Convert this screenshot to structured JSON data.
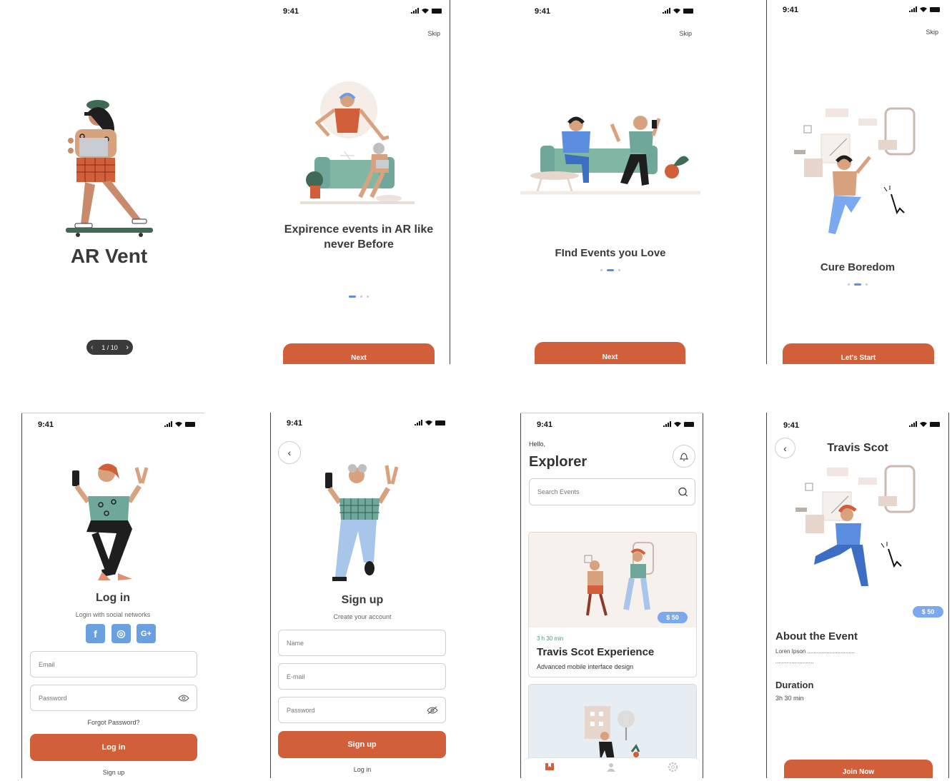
{
  "status_time": "9:41",
  "splash": {
    "title": "AR Vent",
    "pager": "1 / 10"
  },
  "onboarding": [
    {
      "title": "Expirence events in AR like never Before",
      "skip": "Skip",
      "cta": "Next"
    },
    {
      "title": "FInd Events you Love",
      "skip": "Skip",
      "cta": "Next"
    },
    {
      "title": "Cure Boredom",
      "skip": "Skip",
      "cta": "Let's Start"
    }
  ],
  "login": {
    "title": "Log in",
    "subtitle": "Login with social networks",
    "social": [
      "f",
      "◎",
      "G+"
    ],
    "email_placeholder": "Email",
    "password_placeholder": "Password",
    "forgot": "Forgot Password?",
    "cta": "Log in",
    "alt_link": "Sign up"
  },
  "signup": {
    "title": "Sign up",
    "subtitle": "Create your account",
    "name_placeholder": "Name",
    "email_placeholder": "E-mail",
    "password_placeholder": "Password",
    "cta": "Sign up",
    "alt_link": "Log in"
  },
  "explore": {
    "greeting": "Hello,",
    "name": "Explorer",
    "search_placeholder": "Search Events",
    "event": {
      "price": "$ 50",
      "duration": "3 h 30 min",
      "title": "Travis Scot Experience",
      "description": "Advanced mobile interface design"
    },
    "tabs": [
      "ticket-icon",
      "user-icon",
      "settings-icon"
    ]
  },
  "detail": {
    "title": "Travis Scot",
    "price": "$ 50",
    "about_heading": "About the Event",
    "about_text_1": "Loren Ipson ..............................",
    "about_text_2": "........................",
    "duration_heading": "Duration",
    "duration_value": "3h 30 min",
    "cta": "Join Now"
  },
  "colors": {
    "accent": "#d1603a",
    "blue": "#7aa9ee",
    "green": "#6fa89a"
  }
}
